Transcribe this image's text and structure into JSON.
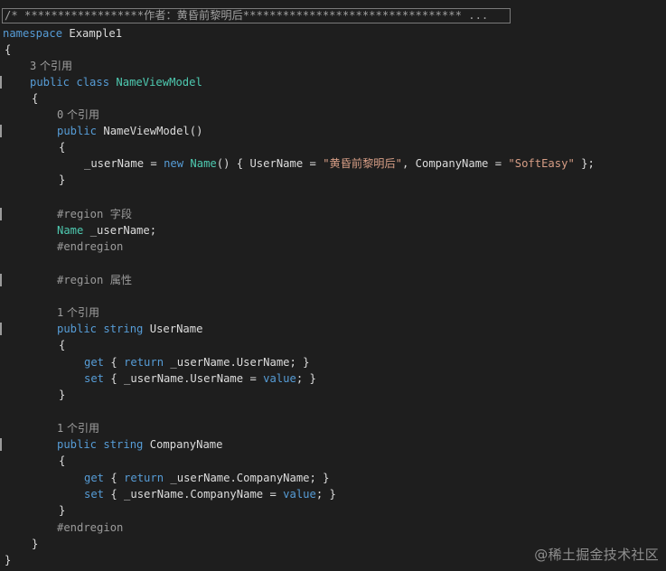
{
  "editor": {
    "collapsed_comment": "/* ******************作者：黄昏前黎明后********************************* ..."
  },
  "code": {
    "kw_namespace": "namespace",
    "ns_name": " Example1",
    "brace_open": "{",
    "brace_close": "}",
    "lens_3": "3",
    "lens_0": "0",
    "lens_1": "1",
    "lens_1b": "1",
    "lens_suffix": " 个引用",
    "kw_public": "public",
    "kw_class": "class",
    "class_name": "NameViewModel",
    "ctor_name": "NameViewModel()",
    "assign_target": "_userName = ",
    "kw_new": "new",
    "type_name": "Name",
    "init_open": "() { UserName = ",
    "str_user": "\"黄昏前黎明后\"",
    "init_mid": ", CompanyName = ",
    "str_company": "\"SoftEasy\"",
    "init_close": " };",
    "region_fields": "#region 字段",
    "field_type": "Name",
    "field_name": " _userName;",
    "endregion": "#endregion",
    "region_props": "#region 属性",
    "kw_string": "string",
    "prop_username": " UserName",
    "prop_company": " CompanyName",
    "kw_get": "get",
    "kw_set": "set",
    "kw_return": "return",
    "kw_value": "value",
    "get_user_body": " _userName.UserName; }",
    "set_user_body": " { _userName.UserName = ",
    "get_company_body": " _userName.CompanyName; }",
    "set_company_body": " { _userName.CompanyName = ",
    "set_tail": "; }"
  },
  "watermark": {
    "text": "@稀土掘金技术社区"
  }
}
